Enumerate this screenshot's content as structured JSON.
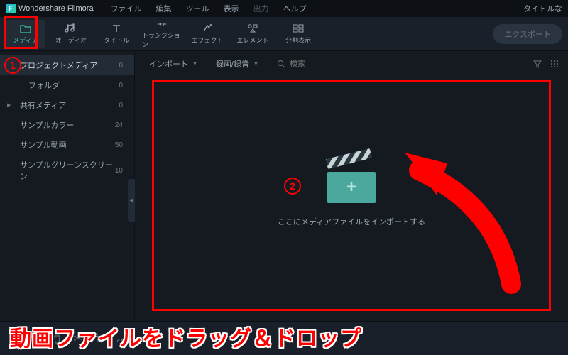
{
  "titlebar": {
    "app_name": "Wondershare Filmora",
    "menus": [
      "ファイル",
      "編集",
      "ツール",
      "表示",
      "出力",
      "ヘルプ"
    ],
    "menu_disabled_index": 4,
    "right_label": "タイトルな"
  },
  "toolbar": {
    "tabs": [
      {
        "label": "メディア",
        "icon": "folder-icon",
        "active": true
      },
      {
        "label": "オーディオ",
        "icon": "audio-icon",
        "active": false
      },
      {
        "label": "タイトル",
        "icon": "title-icon",
        "active": false
      },
      {
        "label": "トランジション",
        "icon": "transition-icon",
        "active": false
      },
      {
        "label": "エフェクト",
        "icon": "effect-icon",
        "active": false
      },
      {
        "label": "エレメント",
        "icon": "element-icon",
        "active": false
      },
      {
        "label": "分割表示",
        "icon": "split-icon",
        "active": false
      }
    ],
    "export_label": "エクスポート"
  },
  "sidebar": {
    "items": [
      {
        "label": "プロジェクトメディア",
        "count": "0",
        "active": true,
        "sub": false,
        "expandable": false
      },
      {
        "label": "フォルダ",
        "count": "0",
        "active": false,
        "sub": true,
        "expandable": false
      },
      {
        "label": "共有メディア",
        "count": "0",
        "active": false,
        "sub": false,
        "expandable": true
      },
      {
        "label": "サンプルカラー",
        "count": "24",
        "active": false,
        "sub": false,
        "expandable": false
      },
      {
        "label": "サンプル動画",
        "count": "50",
        "active": false,
        "sub": false,
        "expandable": false
      },
      {
        "label": "サンプルグリーンスクリーン",
        "count": "10",
        "active": false,
        "sub": false,
        "expandable": false
      }
    ]
  },
  "content_bar": {
    "import_label": "インポート",
    "record_label": "録画/録音",
    "search_placeholder": "検索"
  },
  "drop_zone": {
    "message": "ここにメディアファイルをインポートする"
  },
  "annotations": {
    "circle1": "1",
    "circle2": "2",
    "instruction_text": "動画ファイルをドラッグ＆ドロップ"
  },
  "colors": {
    "annotation_red": "#ff0000",
    "accent_teal": "#3fc0a8"
  }
}
